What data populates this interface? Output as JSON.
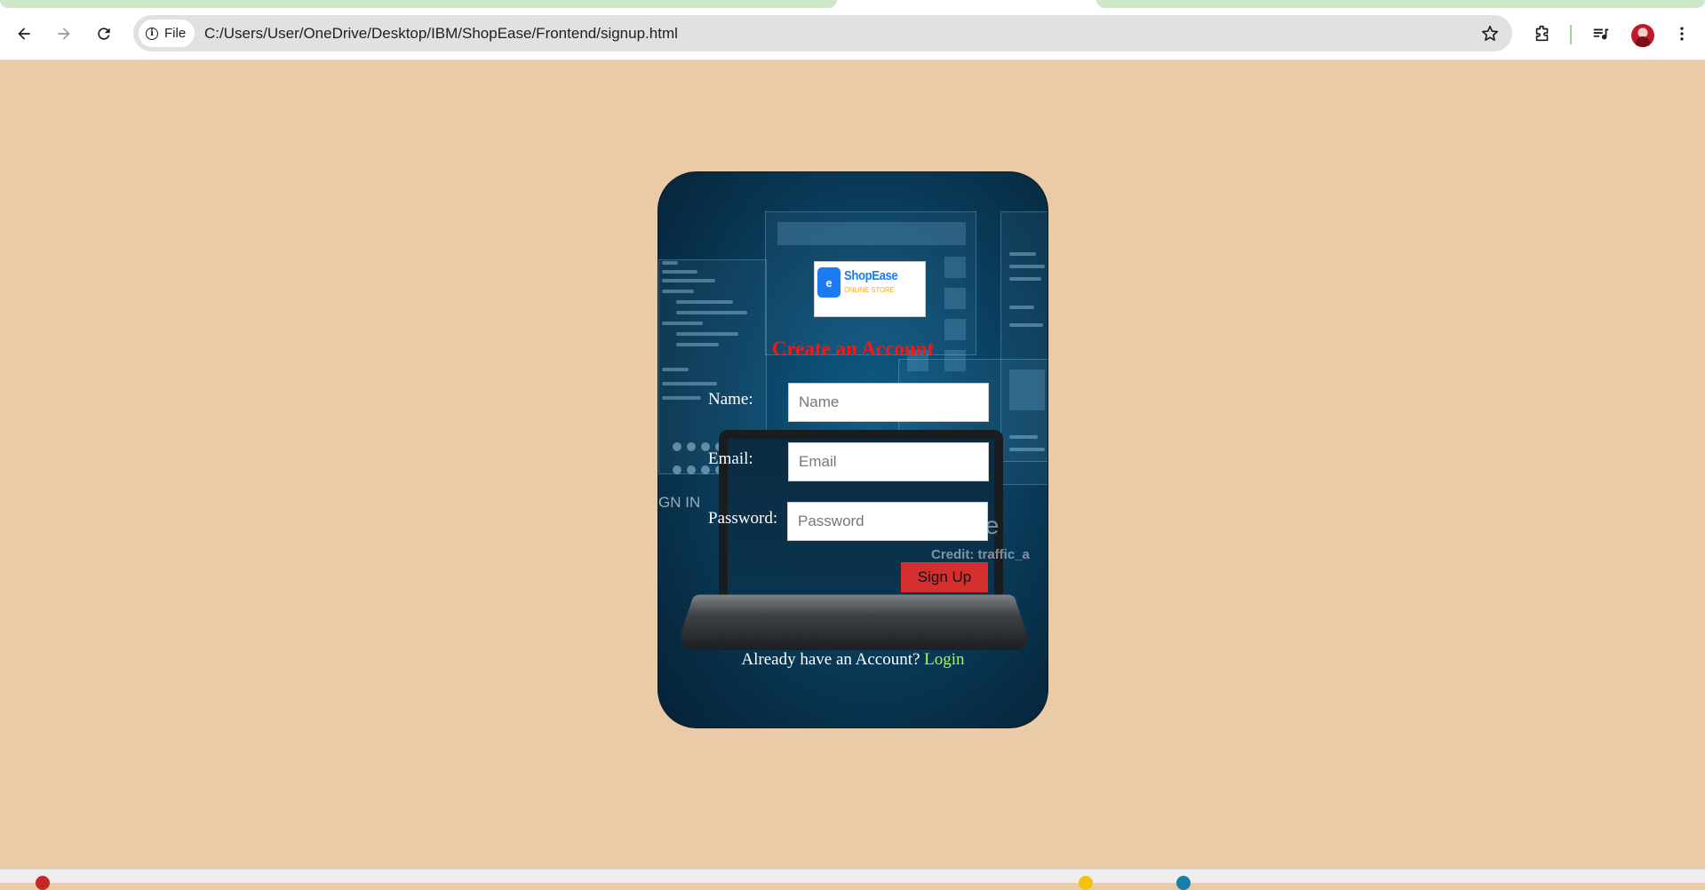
{
  "browser": {
    "site_chip": "File",
    "url": "C:/Users/User/OneDrive/Desktop/IBM/ShopEase/Frontend/signup.html"
  },
  "logo": {
    "mark": "e",
    "name": "ShopEase",
    "tagline": "ONLINE STORE"
  },
  "background": {
    "signin_text": "GN IN",
    "watermark": "image",
    "credit": "Credit: traffic_a"
  },
  "form": {
    "title": "Create an Account",
    "fields": [
      {
        "label": "Name:",
        "placeholder": "Name"
      },
      {
        "label": "Email:",
        "placeholder": "Email"
      },
      {
        "label": "Password:",
        "placeholder": "Password"
      }
    ],
    "submit_label": "Sign Up",
    "footer_text": "Already have an Account?",
    "login_link": "Login"
  },
  "colors": {
    "page_background": "#e9cba7",
    "title": "#ff1414",
    "button": "#d32f2f",
    "login_link": "#9cff45",
    "brand_blue": "#1b7cf2",
    "brand_orange": "#f5a623"
  },
  "icons": [
    "back-icon",
    "forward-icon",
    "reload-icon",
    "info-icon",
    "star-icon",
    "extensions-icon",
    "media-icon",
    "avatar",
    "menu-icon"
  ]
}
